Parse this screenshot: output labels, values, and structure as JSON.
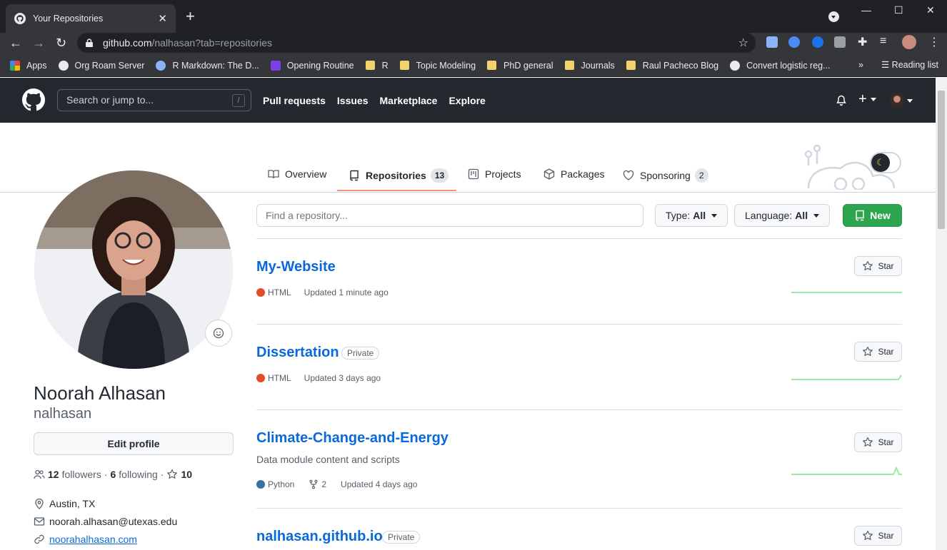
{
  "browser": {
    "tab_title": "Your Repositories",
    "url_host": "github.com",
    "url_path": "/nalhasan?tab=repositories",
    "bookmarks": [
      {
        "label": "Apps",
        "icon": "apps-grid-icon",
        "color": "#ea4335"
      },
      {
        "label": "Org Roam Server",
        "icon": "globe-icon",
        "color": "#e8eaed"
      },
      {
        "label": "R Markdown: The D...",
        "icon": "r-logo-icon",
        "color": "#8ab4f8"
      },
      {
        "label": "Opening Routine",
        "icon": "list-icon",
        "color": "#7b3fe4"
      },
      {
        "label": "R",
        "icon": "folder-icon",
        "color": "#f2d26b"
      },
      {
        "label": "Topic Modeling",
        "icon": "folder-icon",
        "color": "#f2d26b"
      },
      {
        "label": "PhD general",
        "icon": "folder-icon",
        "color": "#f2d26b"
      },
      {
        "label": "Journals",
        "icon": "folder-icon",
        "color": "#f2d26b"
      },
      {
        "label": "Raul Pacheco Blog",
        "icon": "folder-icon",
        "color": "#f2d26b"
      },
      {
        "label": "Convert logistic reg...",
        "icon": "globe-icon",
        "color": "#e8eaed"
      }
    ],
    "more_bookmarks": "»",
    "reading_list": "Reading list"
  },
  "header": {
    "search_placeholder": "Search or jump to...",
    "search_shortcut": "/",
    "nav": [
      "Pull requests",
      "Issues",
      "Marketplace",
      "Explore"
    ]
  },
  "profile_tabs": [
    {
      "label": "Overview",
      "icon": "book-icon"
    },
    {
      "label": "Repositories",
      "icon": "repo-icon",
      "count": "13"
    },
    {
      "label": "Projects",
      "icon": "project-icon"
    },
    {
      "label": "Packages",
      "icon": "package-icon"
    },
    {
      "label": "Sponsoring",
      "icon": "heart-icon",
      "count": "2"
    }
  ],
  "user": {
    "full_name": "Noorah Alhasan",
    "login": "nalhasan",
    "edit_profile": "Edit profile",
    "followers_count": "12",
    "followers_label": "followers",
    "following_count": "6",
    "following_label": "following",
    "stars_count": "10",
    "location": "Austin, TX",
    "email": "noorah.alhasan@utexas.edu",
    "website": "noorahalhasan.com"
  },
  "filters": {
    "find_placeholder": "Find a repository...",
    "type_label": "Type:",
    "type_value": "All",
    "language_label": "Language:",
    "language_value": "All",
    "new_label": "New"
  },
  "repos": [
    {
      "name": "My-Website",
      "private": "",
      "description": "",
      "language": "HTML",
      "language_color": "#e34c26",
      "forks": "",
      "updated": "Updated 1 minute ago",
      "star_label": "Star"
    },
    {
      "name": "Dissertation",
      "private": "Private",
      "description": "",
      "language": "HTML",
      "language_color": "#e34c26",
      "forks": "",
      "updated": "Updated 3 days ago",
      "star_label": "Star"
    },
    {
      "name": "Climate-Change-and-Energy",
      "private": "",
      "description": "Data module content and scripts",
      "language": "Python",
      "language_color": "#3572A5",
      "forks": "2",
      "updated": "Updated 4 days ago",
      "star_label": "Star"
    },
    {
      "name": "nalhasan.github.io",
      "private": "Private",
      "description": "",
      "language": "",
      "language_color": "",
      "forks": "",
      "updated": "",
      "star_label": "Star"
    }
  ],
  "colors": {
    "accent_green": "#2da44e",
    "link_blue": "#0969da",
    "tab_underline": "#fd8c73",
    "header_bg": "#24292f"
  }
}
